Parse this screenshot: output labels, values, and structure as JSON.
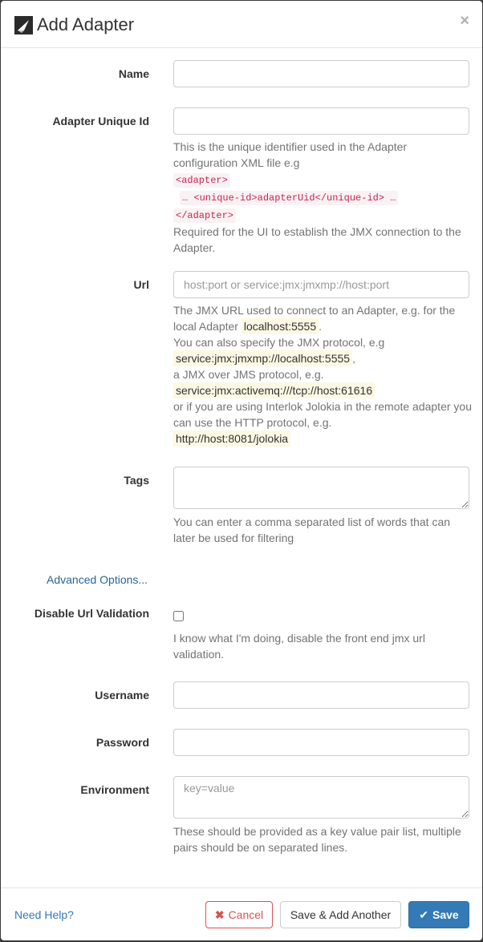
{
  "header": {
    "title": "Add Adapter",
    "close": "×"
  },
  "fields": {
    "name": {
      "label": "Name",
      "value": ""
    },
    "unique_id": {
      "label": "Adapter Unique Id",
      "value": "",
      "help_1": "This is the unique identifier used in the Adapter configuration XML file e.g",
      "code_open": "<adapter>",
      "code_mid": "… <unique-id>adapterUid</unique-id> …",
      "code_close": "</adapter>",
      "help_2": "Required for the UI to establish the JMX connection to the Adapter."
    },
    "url": {
      "label": "Url",
      "placeholder": "host:port or service:jmx:jmxmp://host:port",
      "help_1": "The JMX URL used to connect to an Adapter, e.g. for the local Adapter",
      "example_1": "localhost:5555",
      "help_2": "You can also specify the JMX protocol, e.g",
      "example_2": "service:jmx:jmxmp://localhost:5555",
      "help_3": "a JMX over JMS protocol, e.g.",
      "example_3": "service:jmx:activemq:///tcp://host:61616",
      "help_4": "or if you are using Interlok Jolokia in the remote adapter you can use the HTTP protocol, e.g.",
      "example_4": "http://host:8081/jolokia"
    },
    "tags": {
      "label": "Tags",
      "value": "",
      "help": "You can enter a comma separated list of words that can later be used for filtering"
    },
    "advanced_link": "Advanced Options...",
    "disable_url_validation": {
      "label": "Disable Url Validation",
      "checked": false,
      "help": "I know what I'm doing, disable the front end jmx url validation."
    },
    "username": {
      "label": "Username",
      "value": ""
    },
    "password": {
      "label": "Password",
      "value": ""
    },
    "environment": {
      "label": "Environment",
      "placeholder": "key=value",
      "help": "These should be provided as a key value pair list, multiple pairs should be on separated lines."
    }
  },
  "footer": {
    "need_help": "Need Help?",
    "cancel": "Cancel",
    "save_add_another": "Save & Add Another",
    "save": "Save"
  },
  "colors": {
    "primary": "#337ab7",
    "danger": "#d9534f",
    "code_text": "#c7254e",
    "highlight_bg": "#fcf8e3"
  }
}
